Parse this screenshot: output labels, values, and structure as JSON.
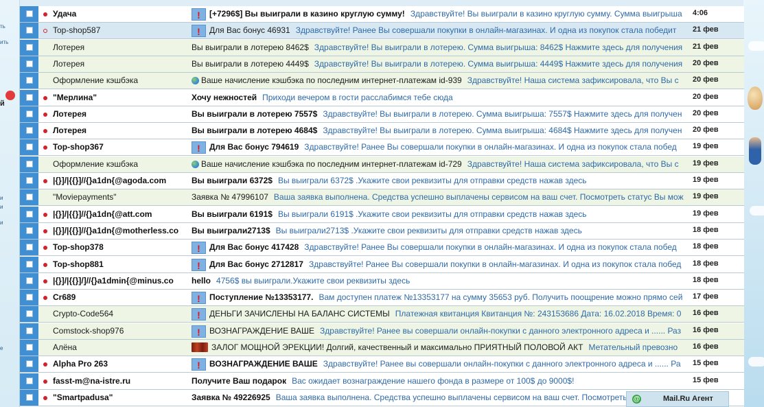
{
  "left_panel": {
    "fragments": [
      "ть",
      "ить",
      "й",
      "и",
      "и",
      "и",
      "е"
    ]
  },
  "messages": [
    {
      "unread": true,
      "dot": "filled",
      "sender": "Удача",
      "icon": "alert-icon",
      "subject": "[+7296$] Вы выиграли в казино круглую сумму!",
      "snippet": "Здравствуйте! Вы выиграли в казино круглую сумму. Сумма выигрыша",
      "date": "4:06"
    },
    {
      "unread": false,
      "selected": true,
      "dot": "hollow",
      "sender": "Top-shop587",
      "icon": "alert-icon",
      "subject": "Для Вас бонус 46931",
      "snippet": "Здравствуйте! Ранее Вы совершали покупки в онлайн-магазинах. И одна из покупок стала победит",
      "date": "21 фев"
    },
    {
      "unread": false,
      "dot": "none",
      "sender": "Лотерея",
      "icon": "",
      "subject": "Вы выиграли в лотерею 8462$",
      "snippet": "Здравствуйте! Вы выиграли в лотерею. Сумма выигрыша: 8462$ Нажмите здесь для получения",
      "date": "21 фев"
    },
    {
      "unread": false,
      "dot": "none",
      "sender": "Лотерея",
      "icon": "",
      "subject": "Вы выиграли в лотерею 4449$",
      "snippet": "Здравствуйте! Вы выиграли в лотерею. Сумма выигрыша: 4449$ Нажмите здесь для получения",
      "date": "20 фев"
    },
    {
      "unread": false,
      "dot": "none",
      "sender": "Оформление кэшбэка",
      "icon": "globe-icon",
      "subject": "Ваше начисление кэшбэка по последним интернет-платежам id-939",
      "snippet": "Здравствуйте! Наша система зафиксировала, что Вы с",
      "date": "20 фев"
    },
    {
      "unread": true,
      "dot": "filled",
      "sender": "\"Мерлина\"",
      "icon": "",
      "subject": "Хочу нежностей",
      "snippet": "Приходи вечером в гости расслабимся тебе сюда",
      "date": "20 фев"
    },
    {
      "unread": true,
      "dot": "filled",
      "sender": "Лотерея",
      "icon": "",
      "subject": "Вы выиграли в лотерею 7557$",
      "snippet": "Здравствуйте! Вы выиграли в лотерею. Сумма выигрыша: 7557$ Нажмите здесь для получен",
      "date": "20 фев"
    },
    {
      "unread": true,
      "dot": "filled",
      "sender": "Лотерея",
      "icon": "",
      "subject": "Вы выиграли в лотерею 4684$",
      "snippet": "Здравствуйте! Вы выиграли в лотерею. Сумма выигрыша: 4684$ Нажмите здесь для получен",
      "date": "20 фев"
    },
    {
      "unread": true,
      "dot": "filled",
      "sender": "Top-shop367",
      "icon": "alert-icon",
      "subject": "Для Вас бонус 794619",
      "snippet": "Здравствуйте! Ранее Вы совершали покупки в онлайн-магазинах. И одна из покупок стала побед",
      "date": "19 фев"
    },
    {
      "unread": false,
      "dot": "none",
      "sender": "Оформление кэшбэка",
      "icon": "globe-icon",
      "subject": "Ваше начисление кэшбэка по последним интернет-платежам id-729",
      "snippet": "Здравствуйте! Наша система зафиксировала, что Вы с",
      "date": "19 фев"
    },
    {
      "unread": true,
      "dot": "filled",
      "sender": "|{}]/|{{}]//{}a1dn{@agoda.com",
      "icon": "",
      "subject": "Вы выиграли 6372$",
      "snippet": "Вы выиграли 6372$ .Укажите свои реквизиты для отправки средств нажав здесь",
      "date": "19 фев"
    },
    {
      "unread": false,
      "dot": "none",
      "sender": "\"Moviepayments\"",
      "icon": "",
      "subject": "Заявка № 47996107",
      "snippet": "Ваша заявка выполнена. Средства успешно выплачены сервисом на ваш счет. Посмотреть статус Вы мож",
      "date": "19 фев"
    },
    {
      "unread": true,
      "dot": "filled",
      "sender": "|{}]/|{{}]//{}a1dn{@att.com",
      "icon": "",
      "subject": "Вы выиграли 6191$",
      "snippet": "Вы выиграли 6191$ .Укажите свои реквизиты для отправки средств нажав здесь",
      "date": "19 фев"
    },
    {
      "unread": true,
      "dot": "filled",
      "sender": "|{}]/|{{}]//{}a1dn{@motherless.co",
      "icon": "",
      "subject": "Вы выиграли2713$",
      "snippet": "Вы выиграли2713$ .Укажите свои реквизиты для отправки средств нажав здесь",
      "date": "18 фев"
    },
    {
      "unread": true,
      "dot": "filled",
      "sender": "Top-shop378",
      "icon": "alert-icon",
      "subject": "Для Вас бонус 417428",
      "snippet": "Здравствуйте! Ранее Вы совершали покупки в онлайн-магазинах. И одна из покупок стала побед",
      "date": "18 фев"
    },
    {
      "unread": true,
      "dot": "filled",
      "sender": "Top-shop881",
      "icon": "alert-icon",
      "subject": "Для Вас бонус 2712817",
      "snippet": "Здравствуйте! Ранее Вы совершали покупки в онлайн-магазинах. И одна из покупок стала побед",
      "date": "18 фев"
    },
    {
      "unread": true,
      "dot": "filled",
      "sender": "|{}]/|{{}]/]//{}a1dmin{@minus.co",
      "icon": "",
      "subject": "hello",
      "snippet": "4756$ вы выиграли.Укажите свои реквизиты здесь",
      "date": "18 фев"
    },
    {
      "unread": true,
      "dot": "filled",
      "sender": "Cr689",
      "icon": "alert-icon",
      "subject": "Поступление №13353177.",
      "snippet": "Вам доступен платеж №13353177 на сумму 35653 руб. Получить поощрение можно прямо сей",
      "date": "17 фев"
    },
    {
      "unread": false,
      "dot": "none",
      "sender": "Crypto-Code564",
      "icon": "alert-icon",
      "subject": "ДЕНЬГИ ЗАЧИСЛЕНЫ НА БАЛАНС СИСТЕМЫ",
      "snippet": "Платежная квитанция Квитанция №: 243153686 Дата: 16.02.2018 Время: 0",
      "date": "16 фев"
    },
    {
      "unread": false,
      "dot": "none",
      "sender": "Comstock-shop976",
      "icon": "alert-icon",
      "subject": "ВОЗНАГРАЖДЕНИЕ ВАШЕ",
      "snippet": "Здравствуйте! Ранее вы совершали онлайн-покупки с данного электронного адреса и ...... Раз",
      "date": "16 фев"
    },
    {
      "unread": false,
      "dot": "none",
      "sender": "Алёна",
      "icon": "image-icon",
      "subject": "ЗАЛОГ МОЩНОЙ ЭРЕКЦИИ! Долгий, качественный и максимально ПРИЯТНЫЙ ПОЛОВОЙ АКТ",
      "snippet": "Метательный превозно",
      "date": "16 фев"
    },
    {
      "unread": true,
      "dot": "filled",
      "sender": "Alpha Pro 263",
      "icon": "alert-icon",
      "subject": "ВОЗНАГРАЖДЕНИЕ ВАШЕ",
      "snippet": "Здравствуйте! Ранее вы совершали онлайн-покупки с данного электронного адреса и ...... Ра",
      "date": "15 фев"
    },
    {
      "unread": true,
      "dot": "filled",
      "sender": "fasst-m@na-istre.ru",
      "icon": "",
      "subject": "Получите Ваш подарок",
      "snippet": "Вас ожидает вознаграждение нашего фонда в размере от 100$ до 9000$!",
      "date": "15 фев"
    },
    {
      "unread": true,
      "dot": "filled",
      "sender": "\"Smartpadusa\"",
      "icon": "",
      "subject": "Заявка № 49226925",
      "snippet": "Ваша заявка выполнена. Средства успешно выплачены сервисом на ваш счет. Посмотреть статус",
      "date": "15 фев"
    }
  ],
  "agent": {
    "label": "Mail.Ru Агент",
    "icon": "@"
  },
  "colors": {
    "checkbox_column": "#3f8fd2",
    "unread_dot": "#d3222a",
    "snippet": "#2f6aa8",
    "read_row": "#eef5e4"
  }
}
